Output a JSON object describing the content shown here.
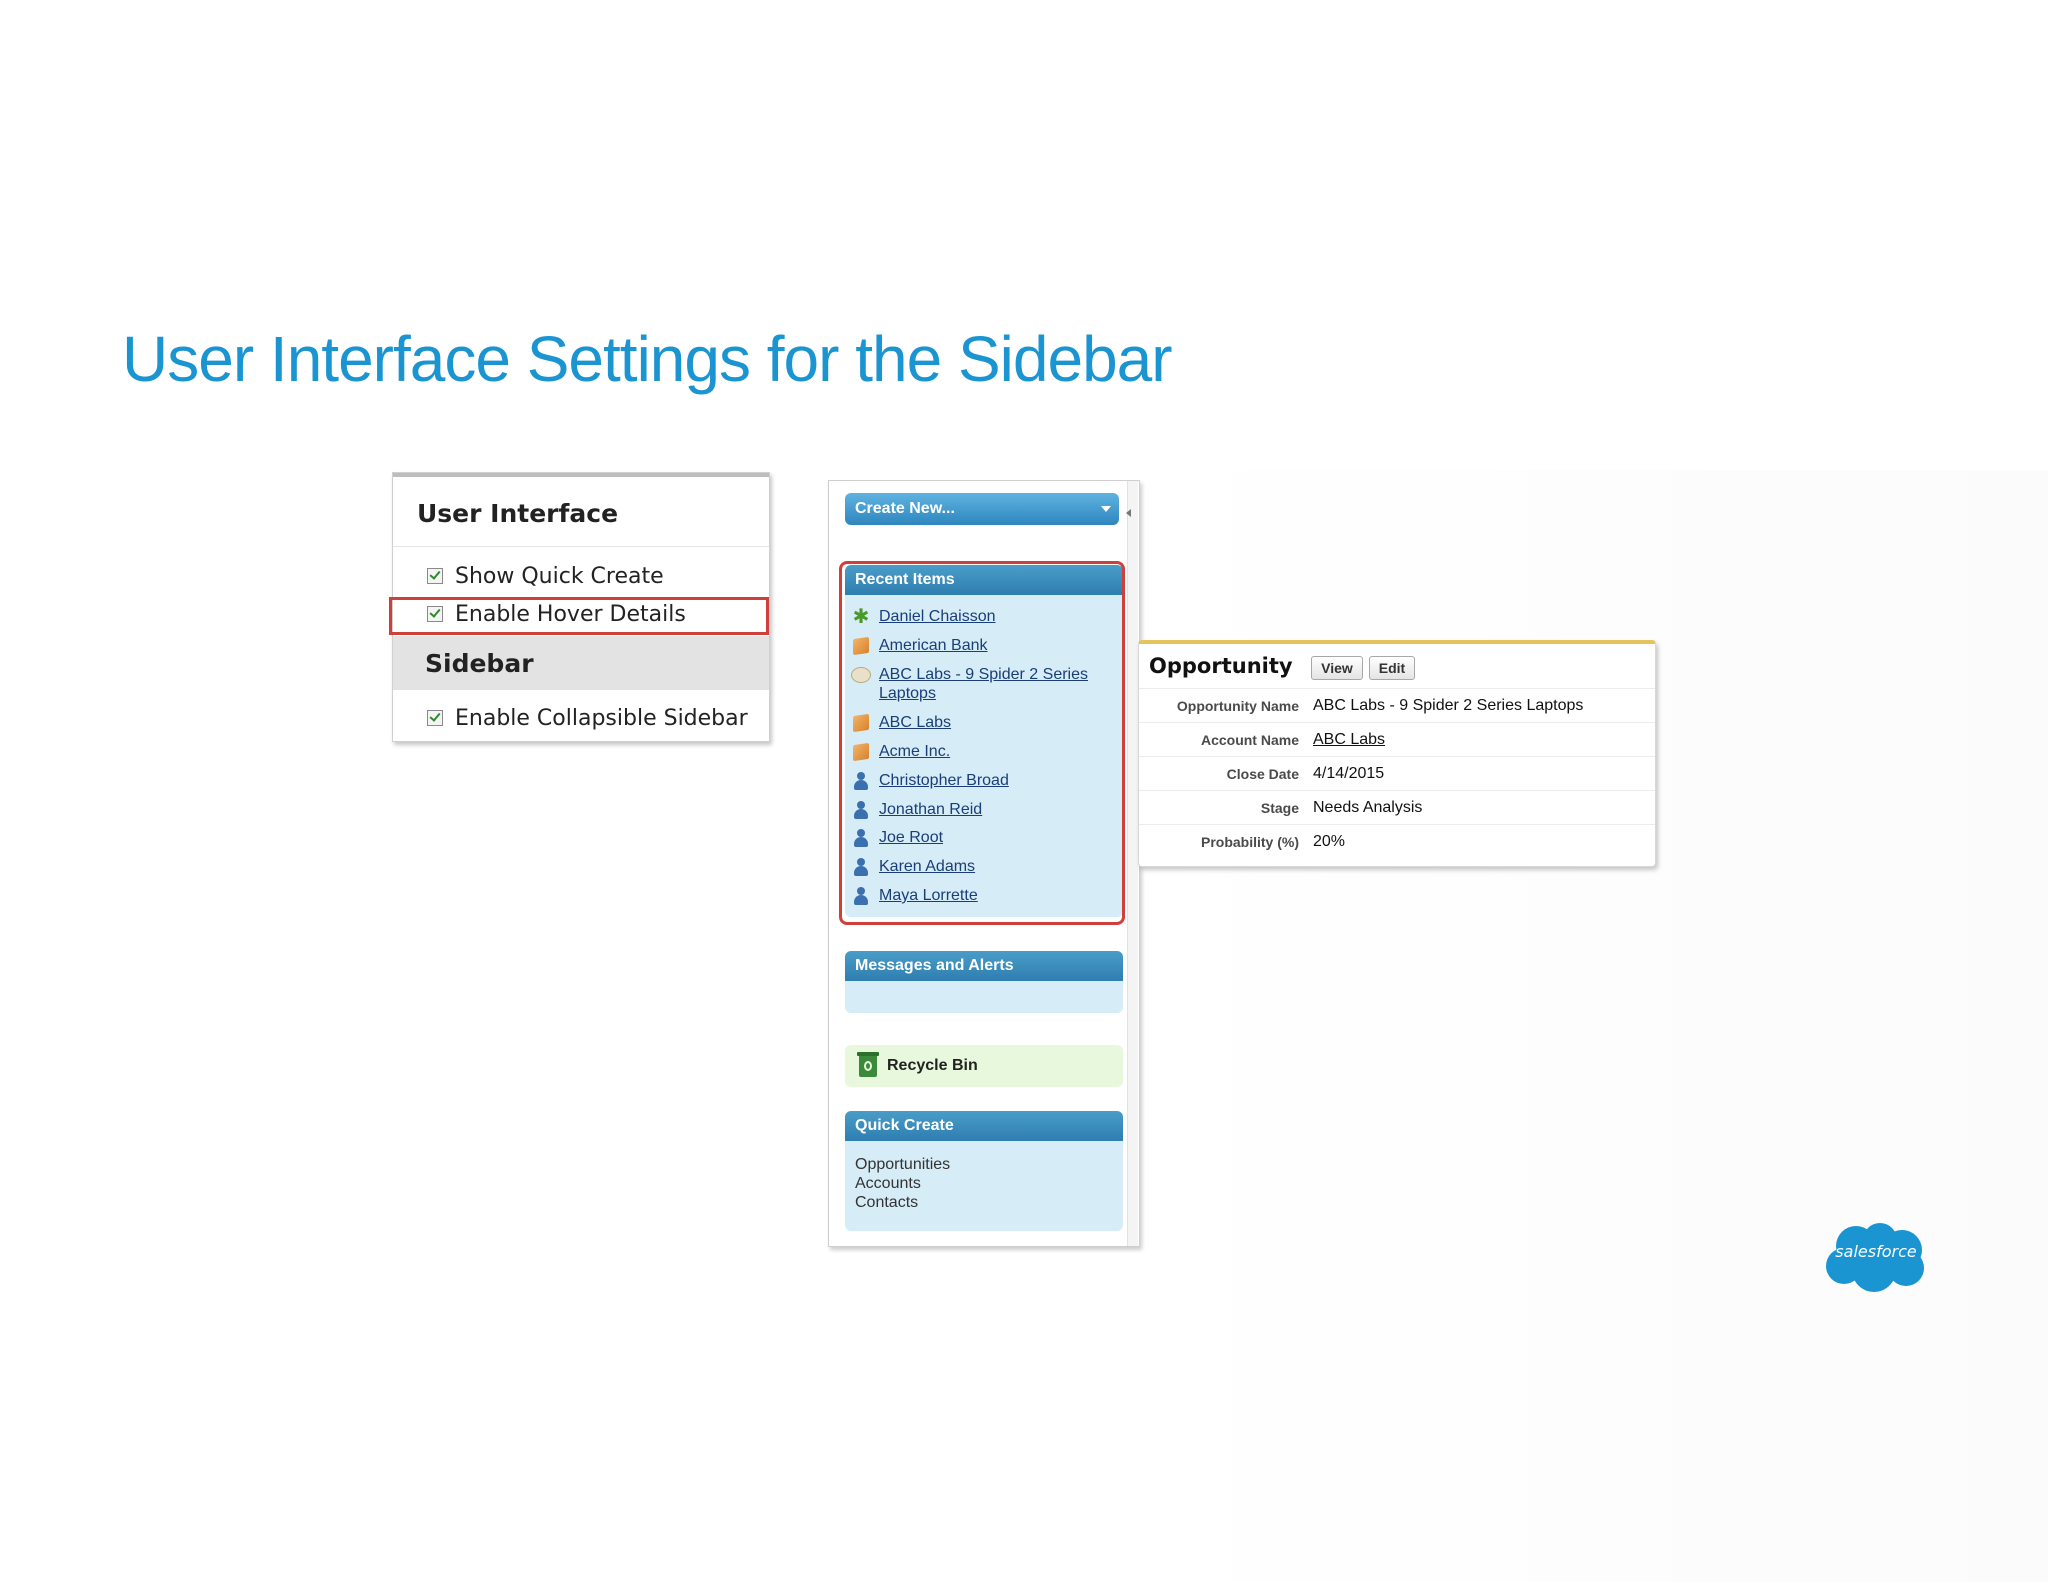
{
  "slide": {
    "title": "User Interface Settings for the Sidebar"
  },
  "ui_settings": {
    "heading": "User Interface",
    "options": [
      {
        "label": "Show Quick Create",
        "checked": true
      },
      {
        "label": "Enable Hover Details",
        "checked": true,
        "highlighted": true
      }
    ],
    "sidebar_heading": "Sidebar",
    "sidebar_options": [
      {
        "label": "Enable Collapsible Sidebar",
        "checked": true
      }
    ]
  },
  "sidebar": {
    "create_new": "Create New...",
    "recent_items": {
      "header": "Recent Items",
      "items": [
        {
          "label": "Daniel Chaisson",
          "icon": "lead-icon"
        },
        {
          "label": "American Bank",
          "icon": "account-icon"
        },
        {
          "label": "ABC Labs - 9 Spider 2 Series Laptops",
          "icon": "opportunity-icon"
        },
        {
          "label": "ABC Labs",
          "icon": "account-icon"
        },
        {
          "label": "Acme Inc.",
          "icon": "account-icon"
        },
        {
          "label": "Christopher Broad",
          "icon": "contact-icon"
        },
        {
          "label": "Jonathan Reid",
          "icon": "contact-icon"
        },
        {
          "label": "Joe Root",
          "icon": "contact-icon"
        },
        {
          "label": "Karen Adams",
          "icon": "contact-icon"
        },
        {
          "label": "Maya Lorrette",
          "icon": "contact-icon"
        }
      ]
    },
    "messages": {
      "header": "Messages and Alerts"
    },
    "recycle_bin": {
      "label": "Recycle Bin",
      "icon": "recycle-bin-icon"
    },
    "quick_create": {
      "header": "Quick Create",
      "items": [
        "Opportunities",
        "Accounts",
        "Contacts"
      ]
    }
  },
  "hover_popup": {
    "title": "Opportunity",
    "view_label": "View",
    "edit_label": "Edit",
    "fields": [
      {
        "label": "Opportunity Name",
        "value": "ABC Labs - 9 Spider 2 Series Laptops",
        "link": false
      },
      {
        "label": "Account Name",
        "value": "ABC Labs",
        "link": true
      },
      {
        "label": "Close Date",
        "value": "4/14/2015",
        "link": false
      },
      {
        "label": "Stage",
        "value": "Needs Analysis",
        "link": false
      },
      {
        "label": "Probability (%)",
        "value": "20%",
        "link": false
      }
    ]
  },
  "logo": {
    "text": "salesforce",
    "color": "#1b94d2"
  },
  "colors": {
    "title": "#1b94d2",
    "highlight": "#d0403a",
    "sidebar_header": "#2e7fb0",
    "popup_accent": "#e6c45c"
  }
}
